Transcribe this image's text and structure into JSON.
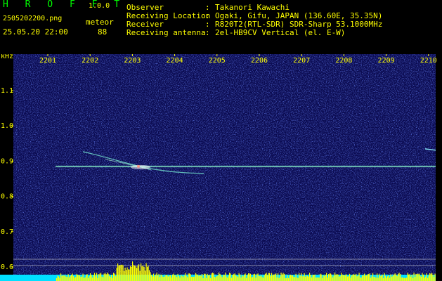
{
  "app": {
    "name": "H R O F F T",
    "version": "1.0.0",
    "filename": "2505202200.png"
  },
  "detection": {
    "label": "meteor",
    "count": "88",
    "datetime": "25.05.20 22:00"
  },
  "info": [
    {
      "label": "Observer",
      "value": "Takanori Kawachi"
    },
    {
      "label": "Receiving Location",
      "value": "Ogaki, Gifu, JAPAN (136.60E, 35.35N)"
    },
    {
      "label": "Receiver",
      "value": "R820T2(RTL-SDR) SDR-Sharp 53.1000MHz"
    },
    {
      "label": "Receiving antenna",
      "value": "2el-HB9CV Vertical (el. E-W)"
    }
  ],
  "chart_data": {
    "type": "heatmap",
    "yunit": "kHz",
    "x_ticks": [
      "2201",
      "2202",
      "2203",
      "2204",
      "2205",
      "2206",
      "2207",
      "2208",
      "2209",
      "2210"
    ],
    "y_ticks": [
      "1.1",
      "1.0",
      "0.9",
      "0.8",
      "0.7",
      "0.6"
    ],
    "ylim": [
      0.57,
      1.2
    ],
    "carrier_khz": 0.885,
    "colors": {
      "background": "#0a0a50",
      "noise": "#2a3aa8",
      "signal": "#7fe0c0",
      "meteor": "#ffffff",
      "activity": "#ffff00",
      "activity_base": "#00e0ff",
      "ref_line": "#d8d8d8"
    }
  }
}
